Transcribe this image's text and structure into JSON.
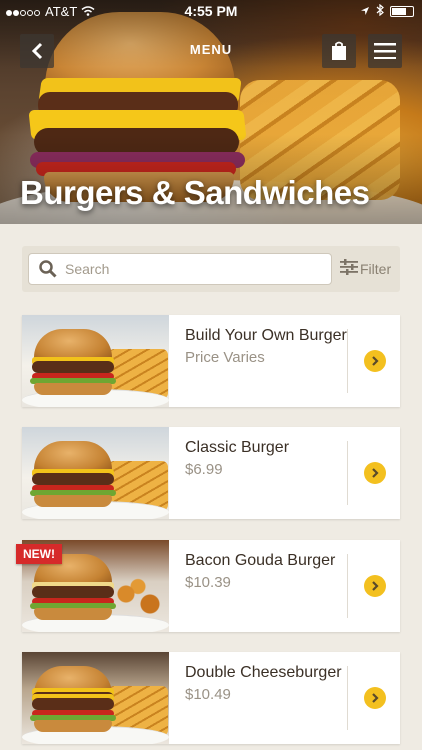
{
  "status_bar": {
    "carrier": "AT&T",
    "time": "4:55 PM"
  },
  "nav": {
    "title": "MENU"
  },
  "hero": {
    "title": "Burgers & Sandwiches"
  },
  "search": {
    "placeholder": "Search",
    "filter_label": "Filter"
  },
  "items": [
    {
      "name": "Build Your Own Burger",
      "price": "Price Varies"
    },
    {
      "name": "Classic Burger",
      "price": "$6.99"
    },
    {
      "name": "Bacon Gouda Burger",
      "price": "$10.39",
      "badge": "NEW!"
    },
    {
      "name": "Double Cheeseburger",
      "price": "$10.49"
    }
  ],
  "colors": {
    "accent": "#f3c01f",
    "badge": "#d62a2a"
  }
}
